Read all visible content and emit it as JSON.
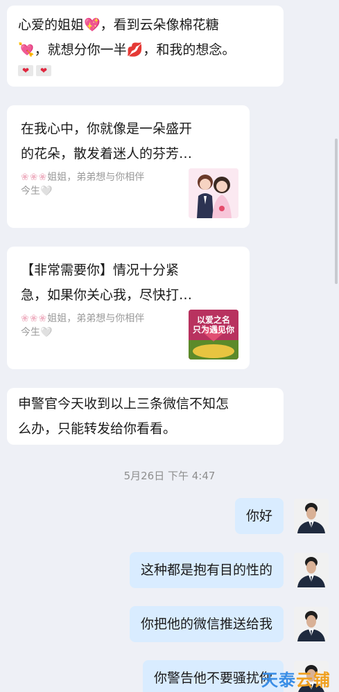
{
  "messages": {
    "m1": {
      "line1": "心爱的姐姐💖，看到云朵像棉花糖",
      "line2": "💘，就想分你一半💋，和我的想念。",
      "hearts": [
        "❤",
        "❤"
      ]
    },
    "m2": {
      "title_line1": "在我心中，你就像是一朵盛开",
      "title_line2": "的花朵，散发着迷人的芬芳…",
      "flowers": "❀❀❀",
      "sub_line1": "姐姐，弟弟想与你相伴",
      "sub_line2": "今生🤍"
    },
    "m3": {
      "title_line1": "【非常需要你】情况十分紧",
      "title_line2": "急，如果你关心我，尽快打…",
      "flowers": "❀❀❀",
      "sub_line1": "姐姐，弟弟想与你相伴",
      "sub_line2": "今生🤍",
      "thumb_text_line1": "以爱之名",
      "thumb_text_line2": "只为遇见你"
    },
    "m4": {
      "line1": "申警官今天收到以上三条微信不知怎",
      "line2": "么办，只能转发给你看看。"
    }
  },
  "timestamp": "5月26日 下午 4:47",
  "outgoing": [
    {
      "text": "你好"
    },
    {
      "text": "这种都是抱有目的性的"
    },
    {
      "text": "你把他的微信推送给我"
    },
    {
      "text": "你警告他不要骚扰你"
    }
  ],
  "watermark": {
    "part1": "天泰",
    "part2": "云铺"
  },
  "colors": {
    "background": "#eef0f6",
    "incoming_bubble": "#ffffff",
    "outgoing_bubble": "#d9ecff",
    "watermark": "#3a8ee6"
  }
}
